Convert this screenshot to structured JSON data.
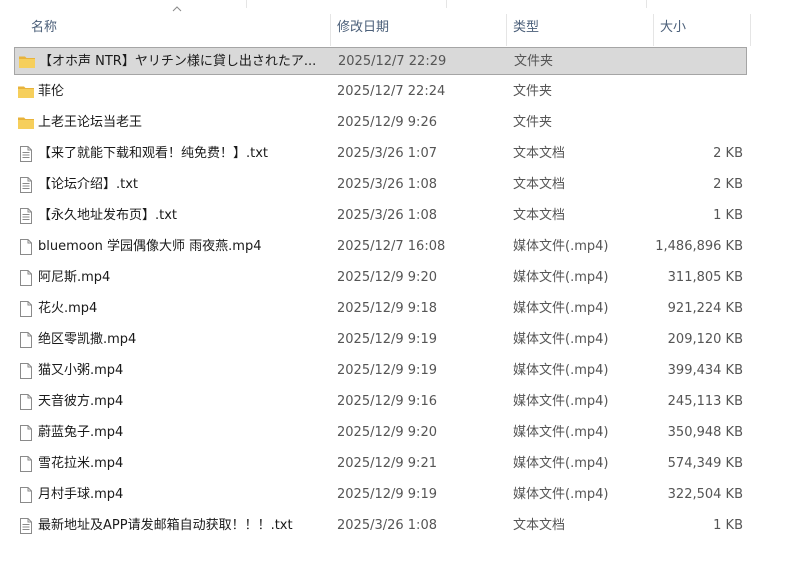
{
  "columns": {
    "name": "名称",
    "date": "修改日期",
    "type": "类型",
    "size": "大小"
  },
  "files": [
    {
      "name": "【オホ声 NTR】ヤリチン様に貸し出されたア...",
      "date": "2025/12/7 22:29",
      "type": "文件夹",
      "size": "",
      "icon": "folder-icon",
      "selected": true
    },
    {
      "name": "菲伦",
      "date": "2025/12/7 22:24",
      "type": "文件夹",
      "size": "",
      "icon": "folder-icon",
      "selected": false
    },
    {
      "name": "上老王论坛当老王",
      "date": "2025/12/9 9:26",
      "type": "文件夹",
      "size": "",
      "icon": "folder-icon",
      "selected": false
    },
    {
      "name": "【来了就能下载和观看！纯免费！】.txt",
      "date": "2025/3/26 1:07",
      "type": "文本文档",
      "size": "2 KB",
      "icon": "text-file-icon",
      "selected": false
    },
    {
      "name": "【论坛介绍】.txt",
      "date": "2025/3/26 1:08",
      "type": "文本文档",
      "size": "2 KB",
      "icon": "text-file-icon",
      "selected": false
    },
    {
      "name": "【永久地址发布页】.txt",
      "date": "2025/3/26 1:08",
      "type": "文本文档",
      "size": "1 KB",
      "icon": "text-file-icon",
      "selected": false
    },
    {
      "name": "bluemoon 学园偶像大师 雨夜燕.mp4",
      "date": "2025/12/7 16:08",
      "type": "媒体文件(.mp4)",
      "size": "1,486,896 KB",
      "icon": "file-icon",
      "selected": false
    },
    {
      "name": "阿尼斯.mp4",
      "date": "2025/12/9 9:20",
      "type": "媒体文件(.mp4)",
      "size": "311,805 KB",
      "icon": "file-icon",
      "selected": false
    },
    {
      "name": "花火.mp4",
      "date": "2025/12/9 9:18",
      "type": "媒体文件(.mp4)",
      "size": "921,224 KB",
      "icon": "file-icon",
      "selected": false
    },
    {
      "name": "绝区零凯撒.mp4",
      "date": "2025/12/9 9:19",
      "type": "媒体文件(.mp4)",
      "size": "209,120 KB",
      "icon": "file-icon",
      "selected": false
    },
    {
      "name": "猫又小粥.mp4",
      "date": "2025/12/9 9:19",
      "type": "媒体文件(.mp4)",
      "size": "399,434 KB",
      "icon": "file-icon",
      "selected": false
    },
    {
      "name": "天音彼方.mp4",
      "date": "2025/12/9 9:16",
      "type": "媒体文件(.mp4)",
      "size": "245,113 KB",
      "icon": "file-icon",
      "selected": false
    },
    {
      "name": "蔚蓝兔子.mp4",
      "date": "2025/12/9 9:20",
      "type": "媒体文件(.mp4)",
      "size": "350,948 KB",
      "icon": "file-icon",
      "selected": false
    },
    {
      "name": "雪花拉米.mp4",
      "date": "2025/12/9 9:21",
      "type": "媒体文件(.mp4)",
      "size": "574,349 KB",
      "icon": "file-icon",
      "selected": false
    },
    {
      "name": "月村手球.mp4",
      "date": "2025/12/9 9:19",
      "type": "媒体文件(.mp4)",
      "size": "322,504 KB",
      "icon": "file-icon",
      "selected": false
    },
    {
      "name": "最新地址及APP请发邮箱自动获取！！！.txt",
      "date": "2025/3/26 1:08",
      "type": "文本文档",
      "size": "1 KB",
      "icon": "text-file-icon",
      "selected": false
    }
  ]
}
